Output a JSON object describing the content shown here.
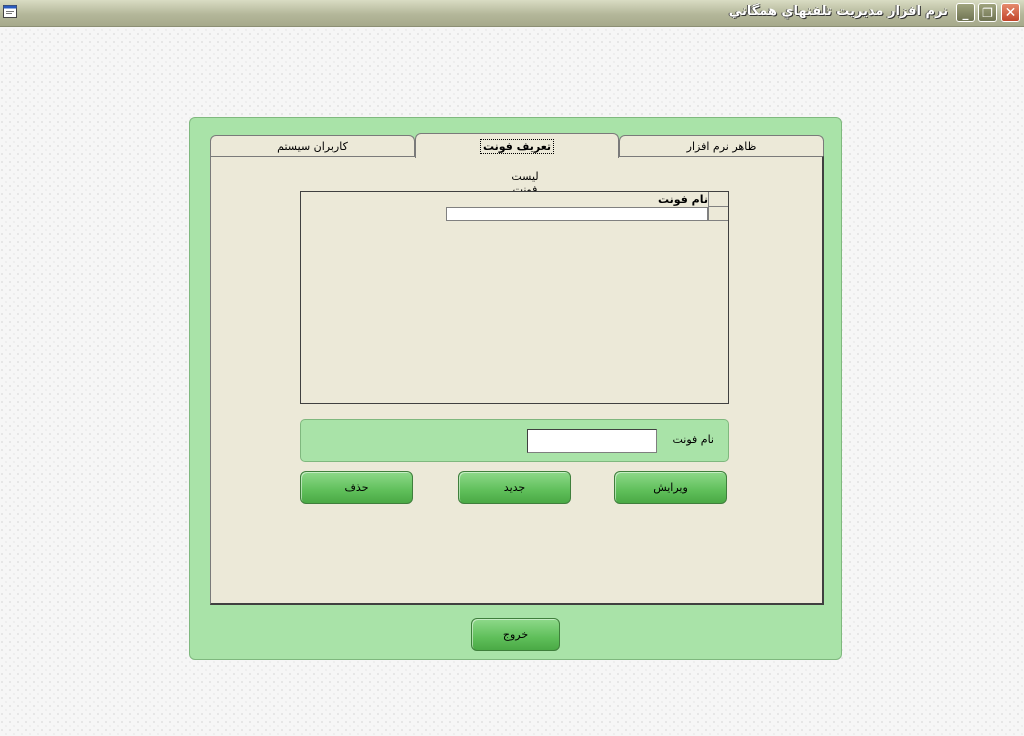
{
  "window": {
    "title": "نرم افزار مديريت تلفنهاي همگاني",
    "minimize_glyph": "_",
    "maximize_glyph": "❐",
    "close_glyph": "✕"
  },
  "tabs": [
    {
      "label": "كاربران سيستم"
    },
    {
      "label": "تعريف فونت"
    },
    {
      "label": "ظاهر نرم افزار"
    }
  ],
  "font_tab": {
    "list_title": "ليست فونت",
    "grid": {
      "columns": [
        "نام فونت"
      ],
      "rows": [
        ""
      ]
    },
    "field_label": "نام فونت",
    "field_value": "",
    "buttons": {
      "edit": "ويرايش",
      "new": "جديد",
      "delete": "حذف"
    }
  },
  "exit_button": "خروج",
  "colors": {
    "panel_green": "#a9e3a8",
    "button_green": "#5fbf5a",
    "tab_face": "#ece9d8",
    "close_red": "#c2452a"
  },
  "icons": {
    "app": "app-window-icon",
    "minimize": "minimize-icon",
    "maximize": "restore-icon",
    "close": "close-icon"
  }
}
